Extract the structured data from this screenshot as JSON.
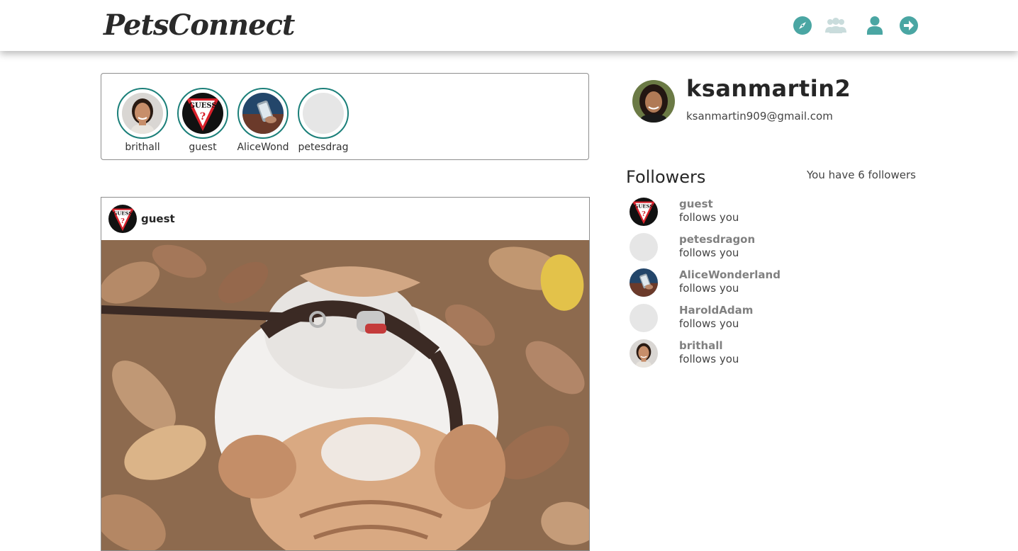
{
  "header": {
    "logo": "PetsConnect",
    "accent_color": "#4aa6a3",
    "icons": [
      "compass-icon",
      "people-icon",
      "user-icon",
      "logout-icon"
    ]
  },
  "stories": [
    {
      "username": "brithall",
      "avatar": "woman-portrait"
    },
    {
      "username": "guest",
      "avatar": "guess-logo"
    },
    {
      "username": "AliceWond",
      "avatar": "phone-photo"
    },
    {
      "username": "petesdrag",
      "avatar": "placeholder"
    }
  ],
  "post": {
    "username": "guest",
    "image": "bulldog-in-leaves"
  },
  "profile": {
    "username": "ksanmartin2",
    "email": "ksanmartin909@gmail.com"
  },
  "followers": {
    "title": "Followers",
    "count_text": "You have 6 followers",
    "items": [
      {
        "username": "guest",
        "subtitle": "follows you",
        "avatar": "guess-logo"
      },
      {
        "username": "petesdragon",
        "subtitle": "follows you",
        "avatar": "placeholder"
      },
      {
        "username": "AliceWonderland",
        "subtitle": "follows you",
        "avatar": "phone-photo"
      },
      {
        "username": "HaroldAdam",
        "subtitle": "follows you",
        "avatar": "placeholder"
      },
      {
        "username": "brithall",
        "subtitle": "follows you",
        "avatar": "woman-portrait"
      }
    ]
  }
}
